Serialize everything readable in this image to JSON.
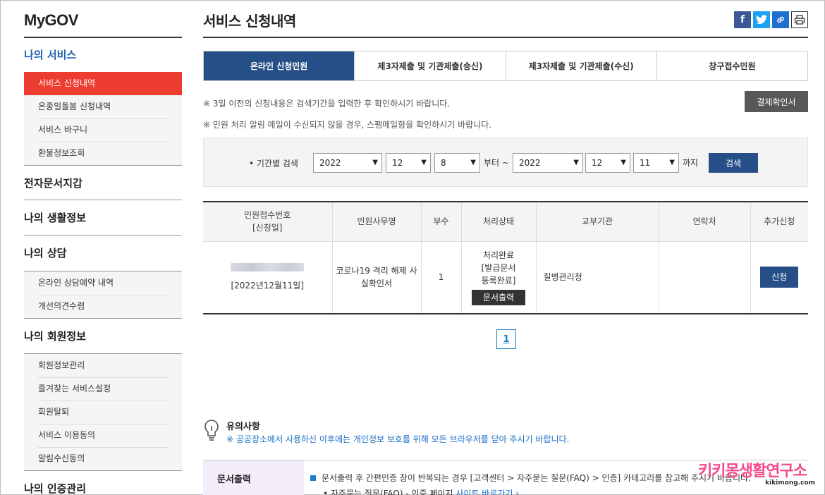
{
  "sidebar": {
    "brand": "MyGOV",
    "sections": [
      {
        "title": "나의 서비스",
        "items": [
          "서비스 신청내역",
          "온종일돌봄 신청내역",
          "서비스 바구니",
          "환불정보조회"
        ]
      },
      {
        "title": "전자문서지갑",
        "items": []
      },
      {
        "title": "나의 생활정보",
        "items": []
      },
      {
        "title": "나의 상담",
        "items": [
          "온라인 상담예약 내역",
          "개선의견수렴"
        ]
      },
      {
        "title": "나의 회원정보",
        "items": [
          "회원정보관리",
          "즐겨찾는 서비스설정",
          "회원탈퇴",
          "서비스 이용동의",
          "알림수신동의"
        ]
      },
      {
        "title": "나의 인증관리",
        "items": []
      }
    ]
  },
  "page": {
    "title": "서비스 신청내역",
    "share_icons": [
      "facebook-icon",
      "twitter-icon",
      "link-icon",
      "print-icon"
    ],
    "tabs": [
      "온라인 신청민원",
      "제3자제출 및 기관제출(송신)",
      "제3자제출 및 기관제출(수신)",
      "창구접수민원"
    ],
    "notice1": "※ 3일 이전의 신청내용은 검색기간을 입력한 후 확인하시기 바랍니다.",
    "notice2": "※ 민원 처리 알림 메일이 수신되지 않을 경우, 스팸메일함을 확인하시기 바랍니다.",
    "pay_button": "결제확인서"
  },
  "search": {
    "label": "• 기간별 검색",
    "from_year": "2022",
    "from_month": "12",
    "from_day": "8",
    "from_text": "부터 ~",
    "to_year": "2022",
    "to_month": "12",
    "to_day": "11",
    "to_text": "까지",
    "button": "검색"
  },
  "table": {
    "headers": {
      "receipt_no": "민원접수번호",
      "receipt_sub": "[신청일]",
      "office": "민원사무명",
      "copies": "부수",
      "status": "처리상태",
      "agency": "교부기관",
      "contact": "연락처",
      "extra": "추가신청"
    },
    "rows": [
      {
        "date": "[2022년12월11일]",
        "office": "코로나19 격리 해제 사실확인서",
        "copies": "1",
        "status": "처리완료 [발급문서 등록완료]",
        "print_button": "문서출력",
        "agency": "질병관리청",
        "contact": "",
        "apply_button": "신청"
      }
    ]
  },
  "pagination": {
    "current": "1"
  },
  "caution": {
    "title": "유의사항",
    "text": "※ 공공장소에서 사용하신 이후에는 개인정보 보호를 위해 모든 브라우저를 닫아 주시기 바랍니다."
  },
  "doc_output": {
    "label": "문서출력",
    "line1": "문서출력 후 간편인증 창이 반복되는 경우 [고객센터 > 자주묻는 질문(FAQ) > 인증] 카테고리를 참고해 주시기 바랍니다.",
    "line2_prefix": "• 자주묻는 질문(FAQ) - 인증 페이지",
    "line2_link": "사이트 바로가기 ›"
  },
  "watermark": {
    "main": "키키몽생활연구소",
    "sub": "kikimong.com"
  }
}
